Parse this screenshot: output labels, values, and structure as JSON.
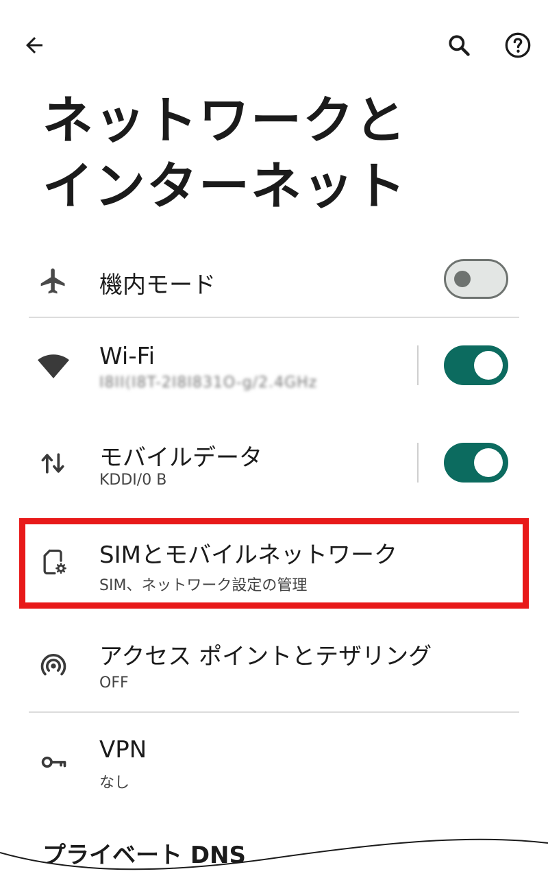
{
  "header": {
    "title_line1": "ネットワークと",
    "title_line2": "インターネット",
    "icons": {
      "back": "arrow-left-icon",
      "search": "search-icon",
      "help": "help-circle-icon"
    }
  },
  "items": [
    {
      "id": "airplane",
      "icon": "airplane-icon",
      "title": "機内モード",
      "toggle": "off"
    },
    {
      "id": "wifi",
      "icon": "wifi-icon",
      "title": "Wi-Fi",
      "subtitle": "I8II(I8T-2I8I831O-g/2.4GHz",
      "subtitle_obscured": true,
      "toggle": "on"
    },
    {
      "id": "mobile-data",
      "icon": "mobile-data-icon",
      "title": "モバイルデータ",
      "subtitle": "KDDI/0 B",
      "toggle": "on"
    },
    {
      "id": "sim",
      "icon": "sim-settings-icon",
      "title": "SIMとモバイルネットワーク",
      "subtitle": "SIM、ネットワーク設定の管理",
      "highlighted": true
    },
    {
      "id": "hotspot",
      "icon": "hotspot-icon",
      "title": "アクセス ポイントとテザリング",
      "subtitle": "OFF"
    },
    {
      "id": "vpn",
      "icon": "key-icon",
      "title": "VPN",
      "subtitle": "なし"
    }
  ],
  "footer": {
    "private_dns_title": "プライベート DNS"
  },
  "colors": {
    "accent": "#0c6b5f",
    "highlight": "#e81919",
    "divider": "#dcdcdc",
    "text": "#1b1b1b"
  }
}
